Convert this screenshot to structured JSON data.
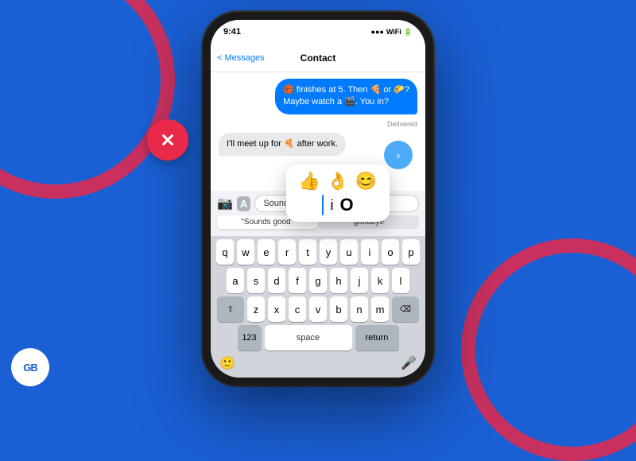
{
  "background": {
    "color": "#1a5fd4"
  },
  "logo": {
    "text": "GB"
  },
  "status_bar": {
    "time": "9:41",
    "icons": "●●●"
  },
  "nav": {
    "back": "< Messages",
    "title": "Contact"
  },
  "messages": [
    {
      "type": "outgoing",
      "text": "🏀 finishes at 5. Then 🍕 or 🌮?\nMaybe watch a 🎬. You in?",
      "status": "Delivered"
    },
    {
      "type": "incoming",
      "text": "I'll meet up for 🍕 after work."
    }
  ],
  "input": {
    "value": "Sounds good",
    "camera_icon": "📷",
    "appstore_icon": "A"
  },
  "predictive": [
    {
      "label": "\"Sounds good\"",
      "active": false
    },
    {
      "label": "goodbye",
      "active": false
    }
  ],
  "emoji_suggestions": [
    "👍",
    "👌",
    "😊"
  ],
  "emoji_cursor_row": [
    "i",
    "O"
  ],
  "keyboard": {
    "rows": [
      [
        "q",
        "w",
        "e",
        "r",
        "t",
        "y",
        "u",
        "i",
        "o",
        "p"
      ],
      [
        "a",
        "s",
        "d",
        "f",
        "g",
        "h",
        "j",
        "k",
        "l"
      ],
      [
        "z",
        "x",
        "c",
        "v",
        "b",
        "n",
        "m"
      ]
    ],
    "space_label": "space",
    "return_label": "return",
    "num_label": "123"
  },
  "red_x_button": {
    "aria": "close-button"
  }
}
